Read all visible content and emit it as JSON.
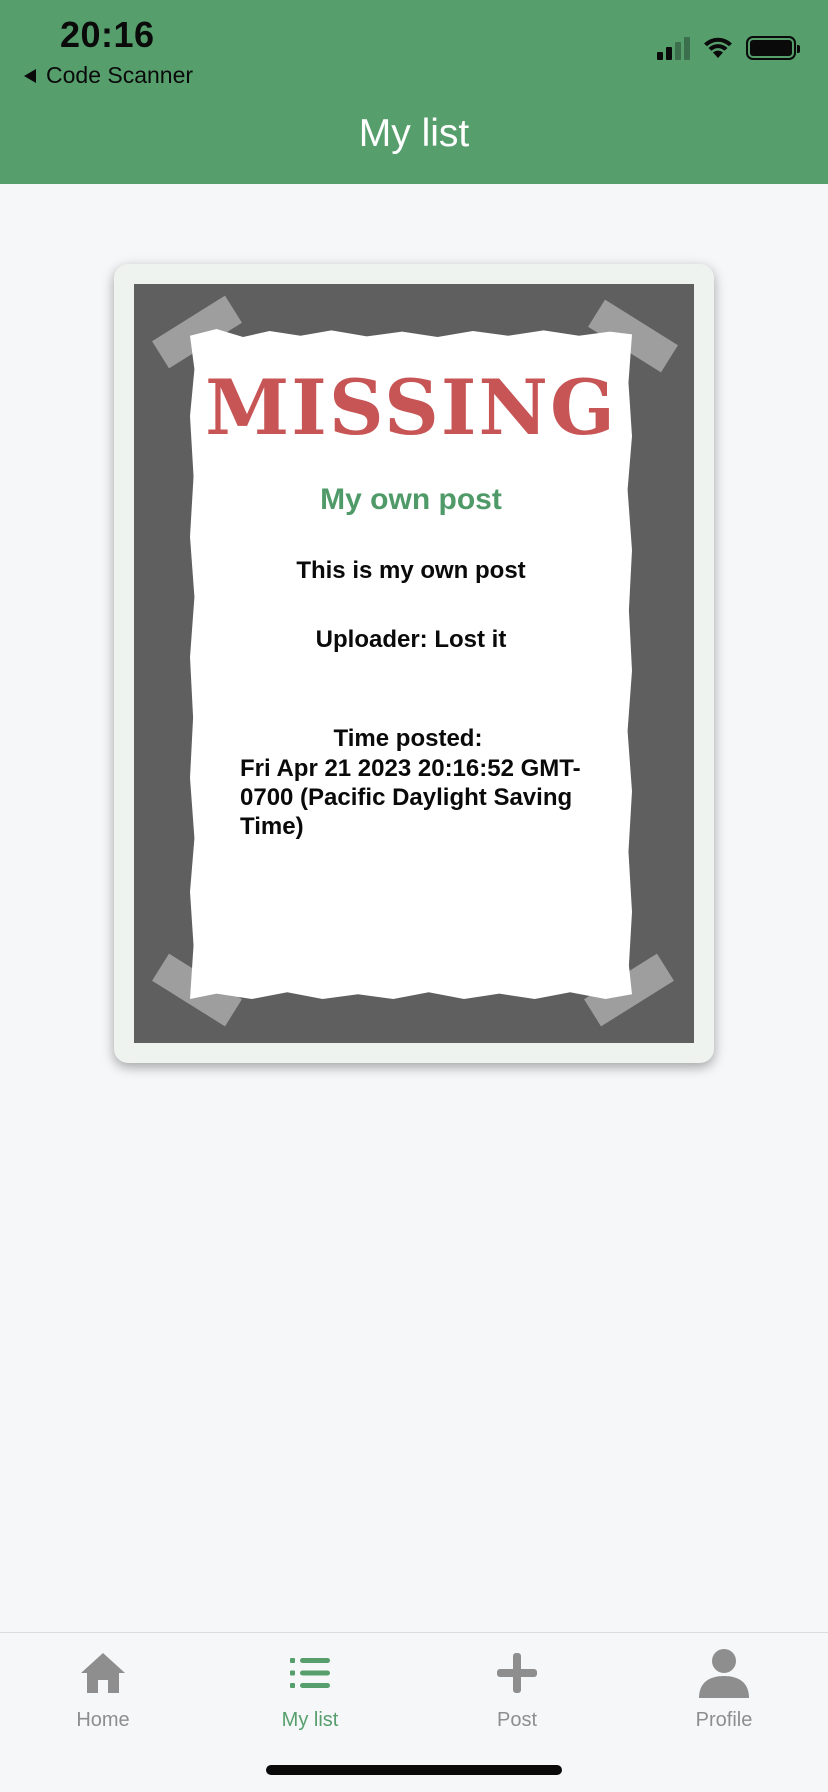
{
  "status_bar": {
    "time": "20:16",
    "back_app": "Code Scanner",
    "icons": [
      "cellular-signal-icon",
      "wifi-icon",
      "battery-icon"
    ]
  },
  "header": {
    "title": "My list",
    "background_color": "#569f6d"
  },
  "post": {
    "heading": "MISSING",
    "title": "My own post",
    "description": "This is my own post",
    "uploader": "Uploader: Lost it",
    "time_label": "Time posted:",
    "time_value": "Fri Apr 21 2023 20:16:52 GMT-0700 (Pacific Daylight Saving Time)",
    "heading_color": "#c85555",
    "title_color": "#4f9a68"
  },
  "tabs": [
    {
      "label": "Home",
      "icon": "home-icon",
      "active": false
    },
    {
      "label": "My list",
      "icon": "list-icon",
      "active": true
    },
    {
      "label": "Post",
      "icon": "plus-icon",
      "active": false
    },
    {
      "label": "Profile",
      "icon": "person-icon",
      "active": false
    }
  ],
  "colors": {
    "accent": "#569f6d",
    "inactive_tab": "#8e8e8e"
  }
}
